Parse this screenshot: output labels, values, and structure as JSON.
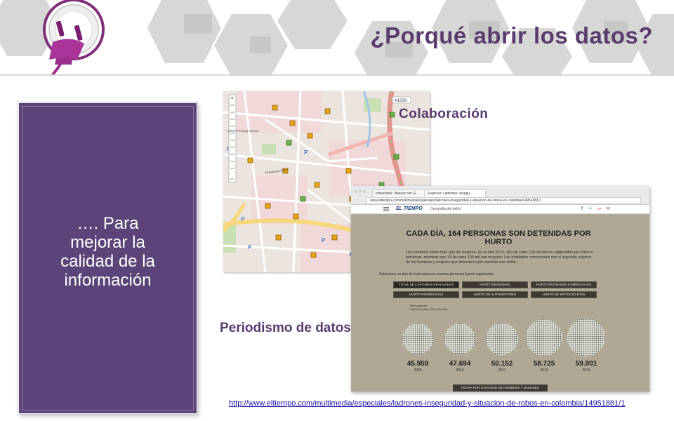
{
  "header": {
    "title": "¿Porqué abrir los datos?"
  },
  "left_panel": {
    "text_line1": "…. Para",
    "text_line2": "mejorar la",
    "text_line3": "calidad de la",
    "text_line4": "información"
  },
  "labels": {
    "colaboracion": "Colaboración",
    "periodismo": "Periodismo de datos"
  },
  "map": {
    "road_label": "A1033",
    "place_label": "Clifton Primary School",
    "street_label": "Freetown Way"
  },
  "browser": {
    "tab1": "privacidad : Buscar con G...",
    "tab2": "Especial: Ladrones, insegu...",
    "url": "www.eltiempo.com/multimedia/especiales/ladrones-inseguridad-y-situacion-de-robos-en-colombia/14951881/1",
    "site_logo": "EL TIEMPO",
    "site_section": "Geografía del delito",
    "headline_line1": "CADA DÍA, 164 PERSONAS SON DETENIDAS POR",
    "headline_line2": "HURTO",
    "paragraph": "Los hombres roban más que las mujeres. En el año 2013, 160 de cada 100 mil fueron capturados por hurto a personas, mientras que 18 de cada 100 mil son mujeres. Las entidades comerciales son el segundo objetivo de los hombres y mujeres que detuvieron por cometer ese delito.",
    "select_prompt": "Seleccione un tipo de hurto para ver cuantas personas fueron capturadas:",
    "buttons": [
      "TOTAL DE CAPTURAS REALIZADAS",
      "HURTO PERSONAS",
      "HURTO ENTIDADES COMERCIALES",
      "HURTO RESIDENCIAS",
      "HURTO DE AUTOMOTORES",
      "HURTO DE MOTOCICLETAS"
    ],
    "legend_line1": "Total capturas",
    "legend_line2": "Capturas (cada 100 personas)",
    "stats": [
      {
        "value": "45.959",
        "year": "2009"
      },
      {
        "value": "47.694",
        "year": "2010"
      },
      {
        "value": "50.152",
        "year": "2011"
      },
      {
        "value": "58.725",
        "year": "2012"
      },
      {
        "value": "59.901",
        "year": "2013"
      }
    ],
    "filter_button": "FILTRA POR CANTIDAD DE HOMBRES Y MUJERES"
  },
  "source_link": "http://www.eltiempo.com/multimedia/especiales/ladrones-inseguridad-y-situacion-de-robos-en-colombia/14951881/1",
  "colors": {
    "accent_purple": "#5c4478",
    "title_purple": "#5b3a6e",
    "plug_magenta": "#9b2d8c"
  },
  "icons": [
    "power-plug-icon",
    "map-zoom-control-icon",
    "facebook-icon",
    "twitter-icon",
    "google-plus-icon",
    "mail-icon",
    "menu-icon"
  ]
}
